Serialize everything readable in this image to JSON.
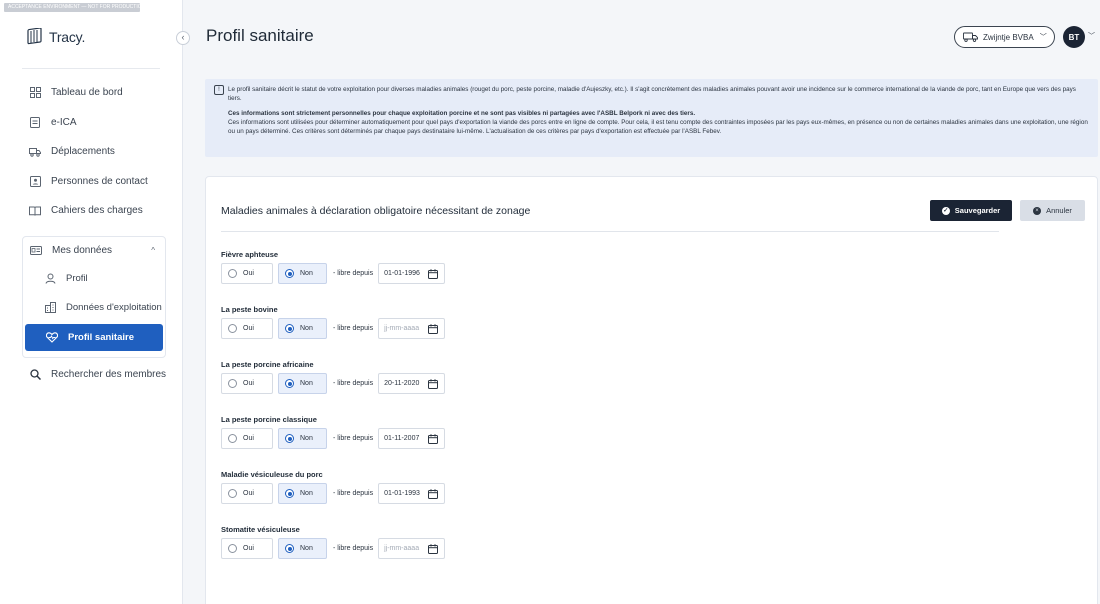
{
  "env_badge": "ACCEPTANCE ENVIRONMENT — NOT FOR PRODUCTION",
  "logo": {
    "name": "Tracy."
  },
  "sidebar": {
    "items": [
      {
        "label": "Tableau de bord",
        "icon": "dashboard-icon"
      },
      {
        "label": "e-ICA",
        "icon": "document-icon"
      },
      {
        "label": "Déplacements",
        "icon": "transport-icon"
      },
      {
        "label": "Personnes de contact",
        "icon": "contact-icon"
      },
      {
        "label": "Cahiers des charges",
        "icon": "book-icon"
      }
    ],
    "group": {
      "label": "Mes données",
      "icon": "id-card-icon",
      "items": [
        {
          "label": "Profil",
          "icon": "user-icon",
          "active": false
        },
        {
          "label": "Données d'exploitation",
          "icon": "building-icon",
          "active": false
        },
        {
          "label": "Profil sanitaire",
          "icon": "heart-health-icon",
          "active": true
        }
      ]
    },
    "search_members": "Rechercher des membres"
  },
  "header": {
    "title": "Profil sanitaire",
    "company": "Zwijntje BVBA",
    "avatar_initials": "BT"
  },
  "info": {
    "p1": "Le profil sanitaire décrit le statut de votre exploitation pour diverses maladies animales (rouget du porc, peste porcine, maladie d'Aujeszky, etc.). Il s'agit concrètement des maladies animales pouvant avoir une incidence sur le commerce international de la viande de porc, tant en Europe que vers des pays tiers.",
    "p2": "Ces informations sont strictement personnelles pour chaque exploitation porcine et ne sont pas visibles ni partagées avec l'ASBL Belpork ni avec des tiers.",
    "p3": "Ces informations sont utilisées pour déterminer automatiquement pour quel pays d'exportation la viande des porcs entre en ligne de compte. Pour cela, il est tenu compte des contraintes imposées par les pays eux-mêmes, en présence ou non de certaines maladies animales dans une exploitation, une région ou un pays déterminé. Ces critères sont déterminés par chaque pays destinataire lui-même. L'actualisation de ces critères par pays d'exportation est effectuée par l'ASBL Febev."
  },
  "card": {
    "title": "Maladies animales à déclaration obligatoire nécessitant de zonage",
    "save_label": "Sauvegarder",
    "cancel_label": "Annuler",
    "oui_label": "Oui",
    "non_label": "Non",
    "libre_label": "- libre depuis",
    "date_placeholder": "jj-mm-aaaa",
    "diseases": [
      {
        "name": "Fièvre aphteuse",
        "selected": "Non",
        "date": "01-01-1996"
      },
      {
        "name": "La peste bovine",
        "selected": "Non",
        "date": ""
      },
      {
        "name": "La peste porcine africaine",
        "selected": "Non",
        "date": "20-11-2020"
      },
      {
        "name": "La peste porcine classique",
        "selected": "Non",
        "date": "01-11-2007"
      },
      {
        "name": "Maladie vésiculeuse du porc",
        "selected": "Non",
        "date": "01-01-1993"
      },
      {
        "name": "Stomatite vésiculeuse",
        "selected": "Non",
        "date": ""
      }
    ]
  },
  "colors": {
    "accent": "#1f5fbf",
    "dark_button": "#1b2434",
    "info_bg": "#e6ecf8"
  }
}
